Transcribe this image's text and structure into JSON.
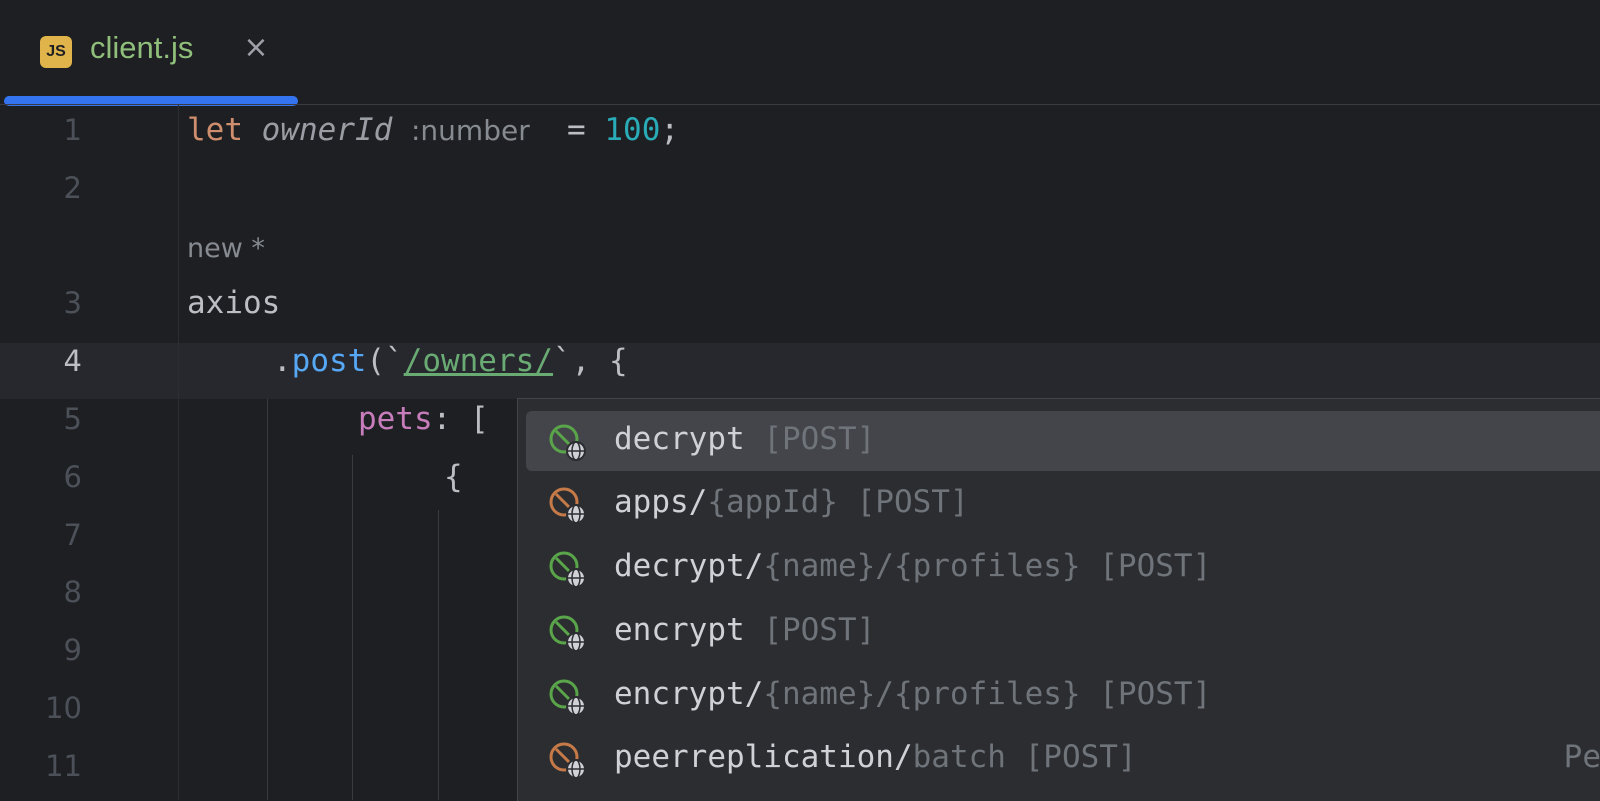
{
  "tab": {
    "badge": "JS",
    "title": "client.js",
    "close": "×"
  },
  "editor": {
    "line_numbers": [
      "1",
      "2",
      "3",
      "4",
      "5",
      "6",
      "7",
      "8",
      "9",
      "10",
      "11"
    ],
    "active_line": "4",
    "line1": {
      "kw": "let",
      "var": "ownerId",
      "hint": ":number",
      "eq": " = ",
      "num": "100",
      "semi": ";"
    },
    "inlay_new": "new *",
    "line3": "axios",
    "line4": {
      "dot": ".",
      "fn": "post",
      "open": "(`",
      "url": "/owners/",
      "close": "`, {"
    },
    "line5": {
      "prop": "pets",
      "rest": ": ["
    },
    "line6": "{"
  },
  "completion": {
    "items": [
      {
        "name": "decrypt",
        "param": "",
        "method": " [POST]",
        "icon": "spring-endpoint-icon",
        "icon_color": "#5aa54a"
      },
      {
        "name": "apps/",
        "param": "{appId}",
        "method": " [POST]",
        "icon": "spring-endpoint-icon",
        "icon_color": "#c57a48"
      },
      {
        "name": "decrypt/",
        "param": "{name}/{profiles}",
        "method": " [POST]",
        "icon": "spring-endpoint-icon",
        "icon_color": "#5aa54a"
      },
      {
        "name": "encrypt",
        "param": "",
        "method": " [POST]",
        "icon": "spring-endpoint-icon",
        "icon_color": "#5aa54a"
      },
      {
        "name": "encrypt/",
        "param": "{name}/{profiles}",
        "method": " [POST]",
        "icon": "spring-endpoint-icon",
        "icon_color": "#5aa54a"
      },
      {
        "name": "peerreplication/",
        "param": "batch",
        "method": " [POST]",
        "icon": "spring-endpoint-icon",
        "icon_color": "#c57a48",
        "tail": "Pe"
      }
    ]
  }
}
